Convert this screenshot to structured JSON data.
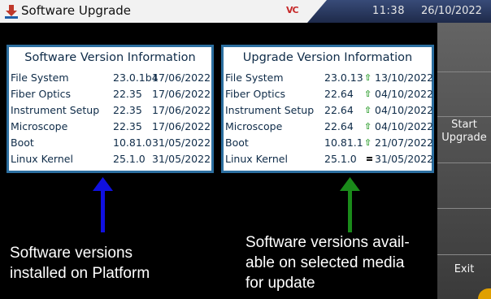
{
  "title_bar": {
    "title": "Software Upgrade",
    "logo_text": "VC",
    "time": "11:38",
    "date": "26/10/2022"
  },
  "software_panel": {
    "title": "Software Version Information",
    "rows": [
      {
        "name": "File System",
        "version": "23.0.1b4",
        "date": "17/06/2022"
      },
      {
        "name": "Fiber Optics",
        "version": "22.35",
        "date": "17/06/2022"
      },
      {
        "name": "Instrument Setup",
        "version": "22.35",
        "date": "17/06/2022"
      },
      {
        "name": "Microscope",
        "version": "22.35",
        "date": "17/06/2022"
      },
      {
        "name": "Boot",
        "version": "10.81.0",
        "date": "31/05/2022"
      },
      {
        "name": "Linux Kernel",
        "version": "25.1.0",
        "date": "31/05/2022"
      }
    ]
  },
  "upgrade_panel": {
    "title": "Upgrade Version Information",
    "rows": [
      {
        "name": "File System",
        "version": "23.0.13",
        "date": "13/10/2022",
        "status": "newer"
      },
      {
        "name": "Fiber Optics",
        "version": "22.64",
        "date": "04/10/2022",
        "status": "newer"
      },
      {
        "name": "Instrument Setup",
        "version": "22.64",
        "date": "04/10/2022",
        "status": "newer"
      },
      {
        "name": "Microscope",
        "version": "22.64",
        "date": "04/10/2022",
        "status": "newer"
      },
      {
        "name": "Boot",
        "version": "10.81.1",
        "date": "21/07/2022",
        "status": "newer"
      },
      {
        "name": "Linux Kernel",
        "version": "25.1.0",
        "date": "31/05/2022",
        "status": "same"
      }
    ]
  },
  "annotations": {
    "left_line1": "Software versions",
    "left_line2": "installed on Platform",
    "right_line1": "Software versions avail-",
    "right_line2": "able on selected media",
    "right_line3": "for update"
  },
  "sidebar": {
    "start_upgrade_line1": "Start",
    "start_upgrade_line2": "Upgrade",
    "exit": "Exit"
  },
  "colors": {
    "panel_border": "#2c6fa0",
    "panel_text": "#0e2b48",
    "newer_arrow": "#2f9e2f",
    "installed_pointer": "#1010e0",
    "upgrade_pointer": "#1a8a1a",
    "upgrade_icon": "#c0392b"
  },
  "icons": {
    "title": "download-arrow-icon",
    "newer": "up-arrow-icon",
    "same": "equal-icon"
  }
}
